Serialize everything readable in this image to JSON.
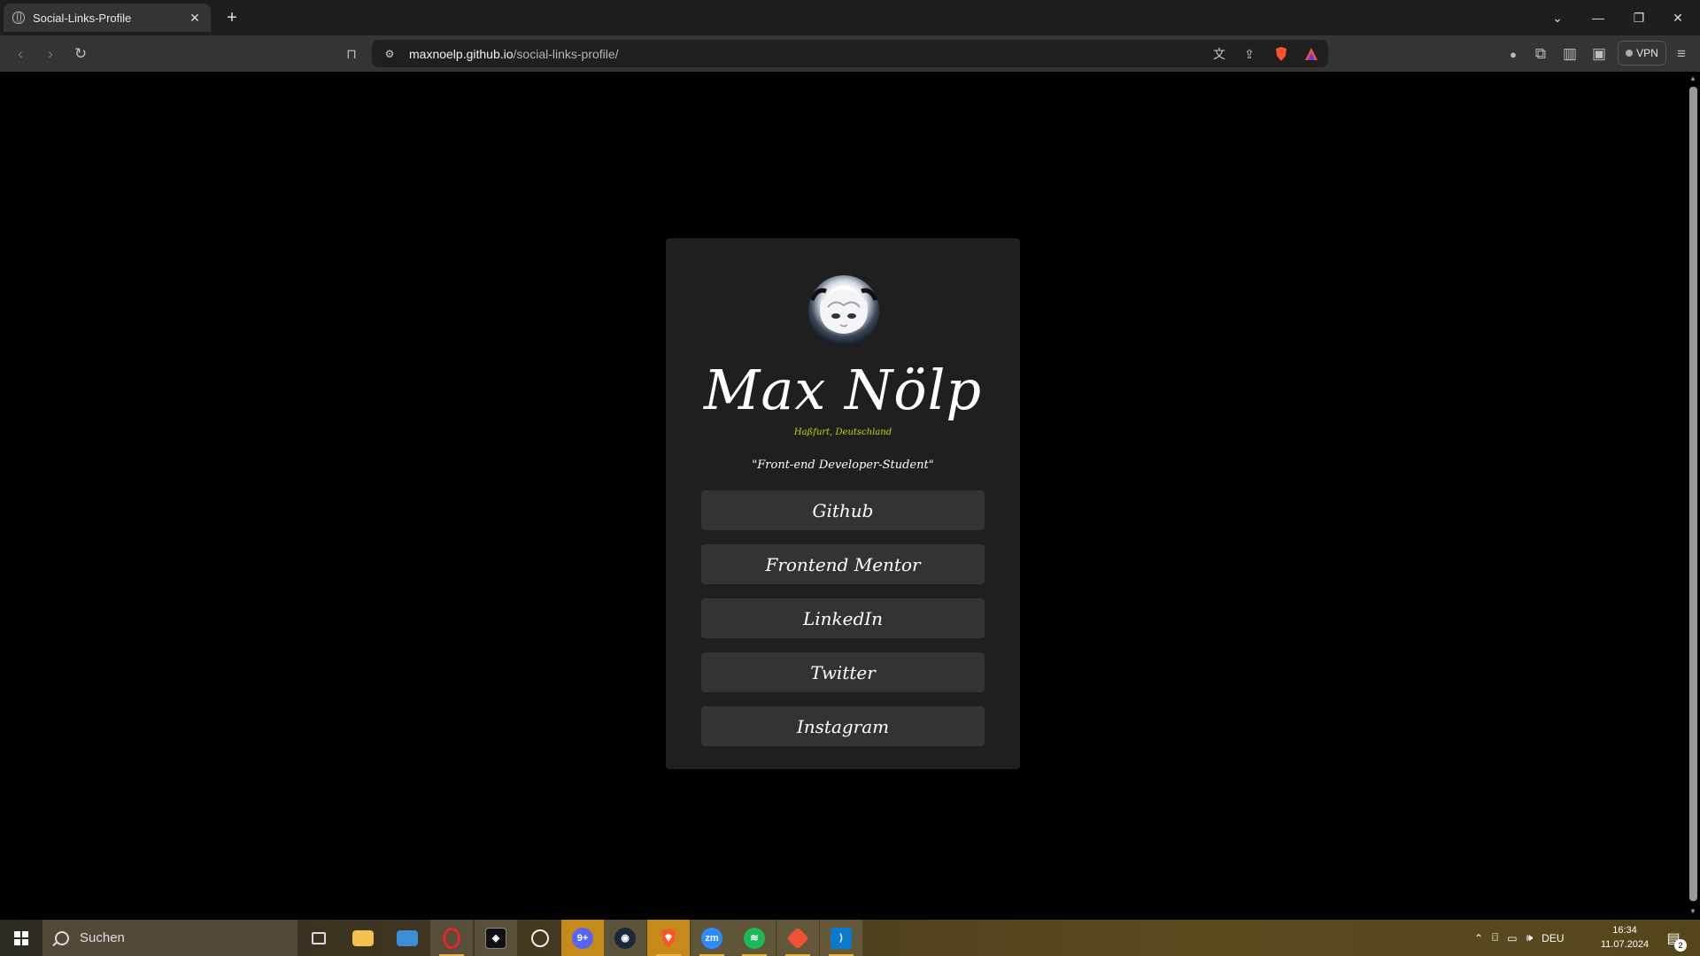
{
  "browser": {
    "tab_title": "Social-Links-Profile",
    "url_host": "maxnoelp.github.io",
    "url_path": "/social-links-profile/",
    "vpn_label": "VPN",
    "new_tab_symbol": "+",
    "close_symbol": "✕"
  },
  "profile": {
    "name": "Max Nölp",
    "location": "Haßfurt, Deutschland",
    "bio": "\"Front-end Developer-Student\"",
    "links": [
      {
        "label": "Github"
      },
      {
        "label": "Frontend Mentor"
      },
      {
        "label": "LinkedIn"
      },
      {
        "label": "Twitter"
      },
      {
        "label": "Instagram"
      }
    ]
  },
  "taskbar": {
    "search_placeholder": "Suchen",
    "language": "DEU",
    "time": "16:34",
    "date": "11.07.2024",
    "notification_count": "2",
    "apps": [
      {
        "name": "task-view-icon"
      },
      {
        "name": "file-explorer-icon"
      },
      {
        "name": "control-panel-icon"
      },
      {
        "name": "opera-icon"
      },
      {
        "name": "app-icon"
      },
      {
        "name": "ubisoft-icon"
      },
      {
        "name": "discord-icon"
      },
      {
        "name": "steam-icon"
      },
      {
        "name": "brave-icon"
      },
      {
        "name": "zoom-icon"
      },
      {
        "name": "spotify-icon"
      },
      {
        "name": "git-icon"
      },
      {
        "name": "vscode-icon"
      }
    ]
  },
  "colors": {
    "page_background": "#000000",
    "card_background": "#1f1f1f",
    "button_background": "#333333",
    "location_text": "#c8d400",
    "text": "#ffffff"
  }
}
